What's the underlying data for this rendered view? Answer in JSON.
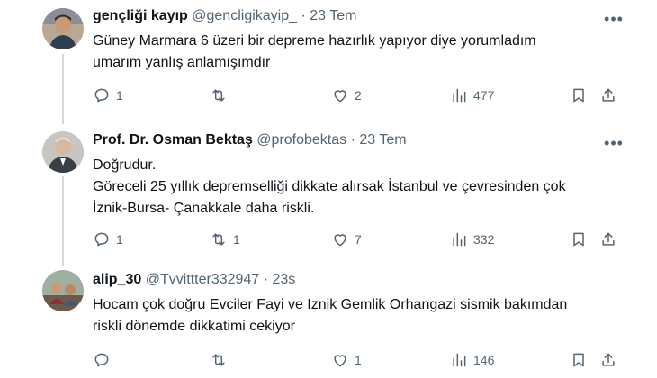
{
  "tweets": [
    {
      "name": "gençliği kayıp",
      "handle": "@gencligikayip_",
      "dot": "·",
      "time": "23 Tem",
      "lines": [
        "Güney Marmara 6 üzeri bir depreme hazırlık yapıyor diye yorumladım",
        "umarım yanlış anlamışımdır"
      ],
      "replies": "1",
      "retweets": "",
      "likes": "2",
      "views": "477"
    },
    {
      "name": "Prof. Dr. Osman Bektaş",
      "handle": "@profobektas",
      "dot": "·",
      "time": "23 Tem",
      "lines": [
        "Doğrudur.",
        "Göreceli 25 yıllık depremselliği dikkate alırsak İstanbul ve çevresinden çok",
        "İznik-Bursa- Çanakkale daha riskli."
      ],
      "replies": "1",
      "retweets": "1",
      "likes": "7",
      "views": "332"
    },
    {
      "name": "alip_30",
      "handle": "@Tvvittter332947",
      "dot": "·",
      "time": "23s",
      "lines": [
        "Hocam çok doğru Evciler Fayi ve Iznik Gemlik Orhangazi sismik bakımdan",
        "riskli dönemde dikkatimi cekiyor"
      ],
      "replies": "",
      "retweets": "",
      "likes": "1",
      "views": "146"
    }
  ],
  "icons": {
    "more": "more-icon",
    "reply": "reply-icon",
    "retweet": "retweet-icon",
    "like": "heart-icon",
    "views": "views-icon",
    "bookmark": "bookmark-icon",
    "share": "share-icon"
  }
}
